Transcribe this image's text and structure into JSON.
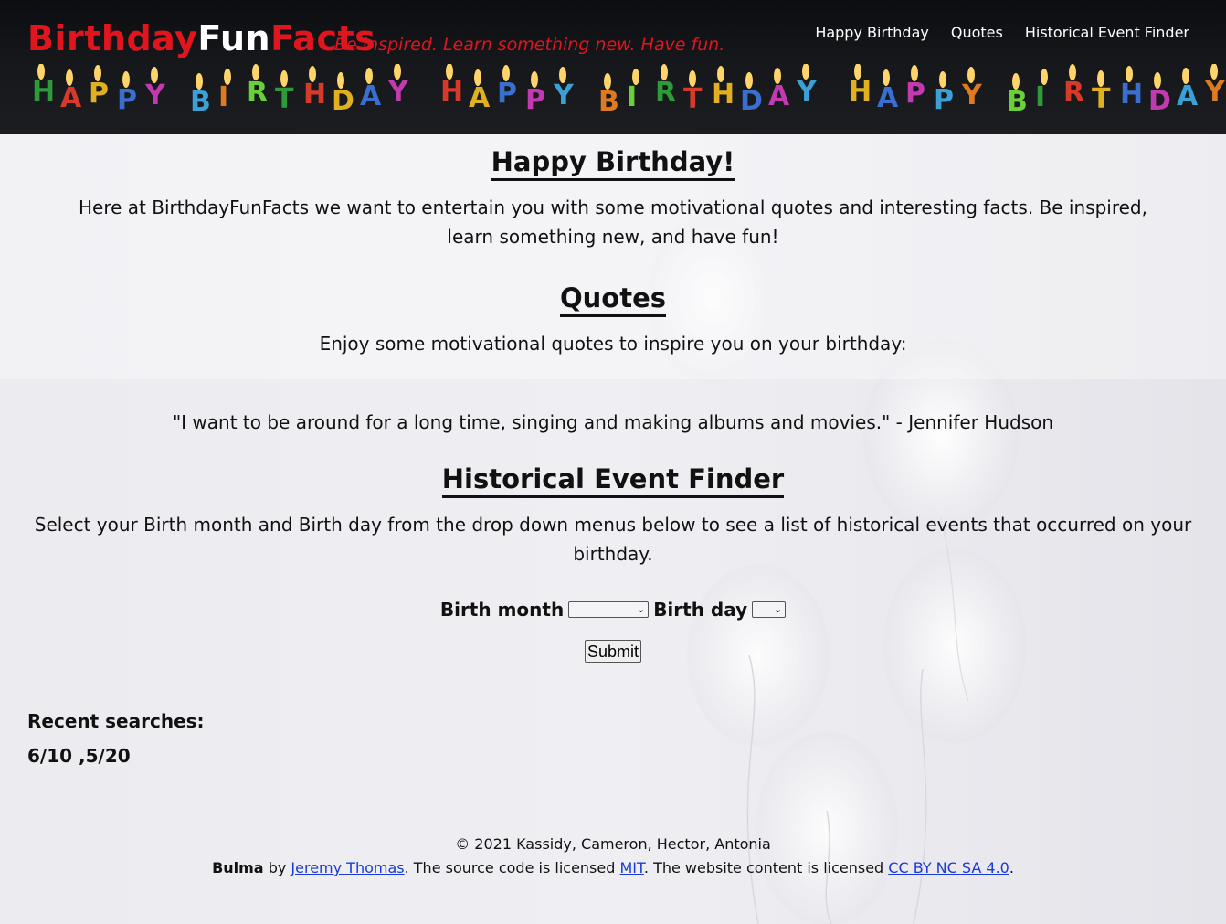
{
  "header": {
    "brand_part1": "Birthday",
    "brand_part2": "Fun",
    "brand_part3": "Facts",
    "tagline": "Be inspired. Learn something new. Have fun.",
    "nav": [
      "Happy Birthday",
      "Quotes",
      "Historical Event Finder"
    ],
    "banner_text": "HAPPY BIRTHDAY"
  },
  "main": {
    "title": "Happy Birthday!",
    "intro": "Here at BirthdayFunFacts we want to entertain you with some motivational quotes and interesting facts. Be inspired, learn something new, and have fun!",
    "quotes_title": "Quotes",
    "quotes_intro": "Enjoy some motivational quotes to inspire you on your birthday:",
    "quote": "\"I want to be around for a long time, singing and making albums and movies.\" - Jennifer Hudson",
    "finder_title": "Historical Event Finder",
    "finder_intro": "Select your Birth month and Birth day from the drop down menus below to see a list of historical events that occurred on your birthday.",
    "month_label": "Birth month",
    "month_value": "",
    "day_label": "Birth day",
    "day_value": "",
    "submit_label": "Submit",
    "recent_label": "Recent searches:",
    "recent_values": "6/10 ,5/20"
  },
  "footer": {
    "copyright": "© 2021 Kassidy, Cameron, Hector, Antonia",
    "bulma": "Bulma",
    "by": " by ",
    "author": "Jeremy Thomas",
    "code_text": ". The source code is licensed ",
    "mit": "MIT",
    "content_text": ". The website content is licensed ",
    "license": "CC BY NC SA 4.0",
    "end": "."
  },
  "colors": {
    "brand_red": "#e0151d",
    "header_bg": "#0c0d10",
    "link_blue": "#1a3ad9"
  }
}
